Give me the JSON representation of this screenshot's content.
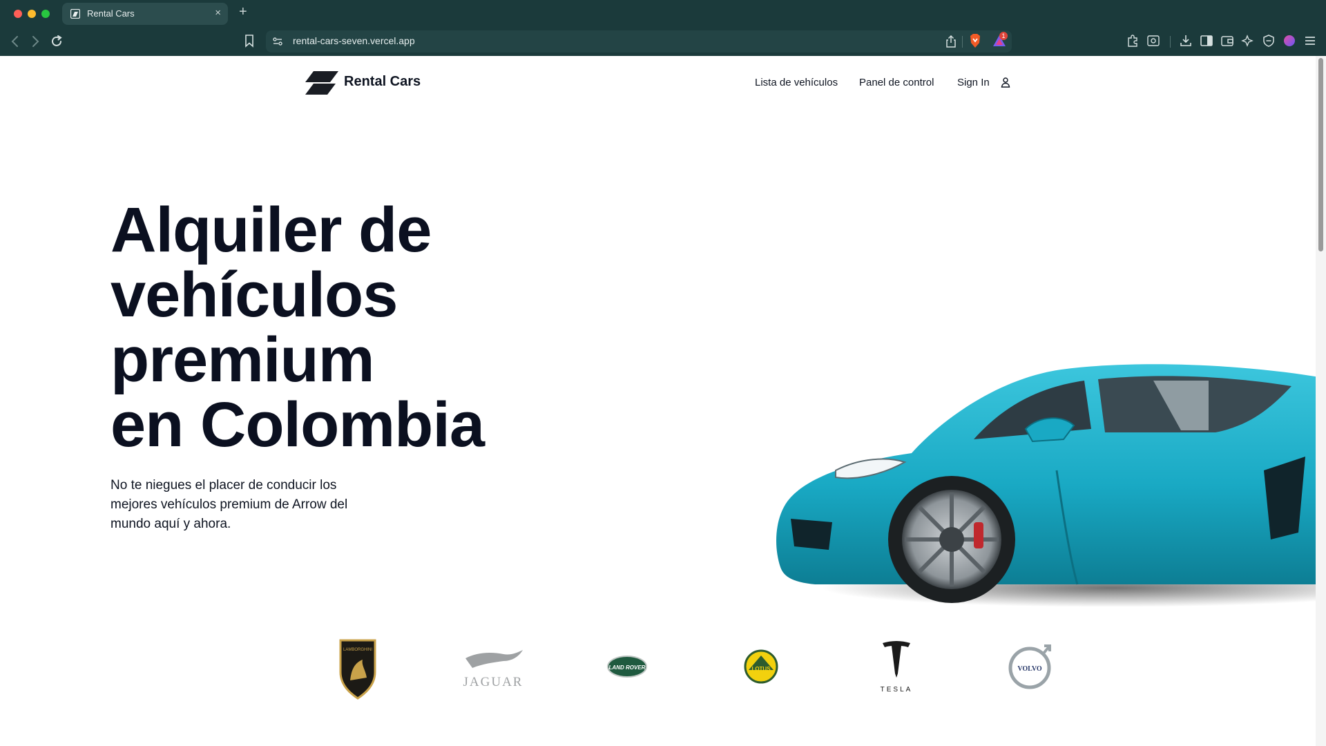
{
  "browser": {
    "tab_title": "Rental Cars",
    "tab_close": "×",
    "new_tab": "+",
    "url": "rental-cars-seven.vercel.app",
    "rewards_count": "1"
  },
  "header": {
    "brand": "Rental Cars",
    "nav": [
      "Lista de vehículos",
      "Panel de control",
      "Sign In"
    ]
  },
  "hero": {
    "title_lines": [
      "Alquiler de",
      "vehículos",
      "premium",
      "en Colombia"
    ],
    "subtitle_lines": [
      "No te niegues el placer de conducir los",
      "mejores vehículos premium de Arrow del",
      "mundo aquí y ahora."
    ]
  },
  "brands": [
    {
      "name": "Lamborghini",
      "text": "LAMBORGHINI"
    },
    {
      "name": "Jaguar",
      "text": "JAGUAR"
    },
    {
      "name": "Land Rover",
      "text": "LAND ROVER"
    },
    {
      "name": "Lotus",
      "text": "LOTUS"
    },
    {
      "name": "Tesla",
      "text": "TESLA"
    },
    {
      "name": "Volvo",
      "text": "VOLVO"
    }
  ],
  "colors": {
    "chrome": "#1b3a3b",
    "text_dark": "#0b1020",
    "car": "#19a9c4"
  }
}
